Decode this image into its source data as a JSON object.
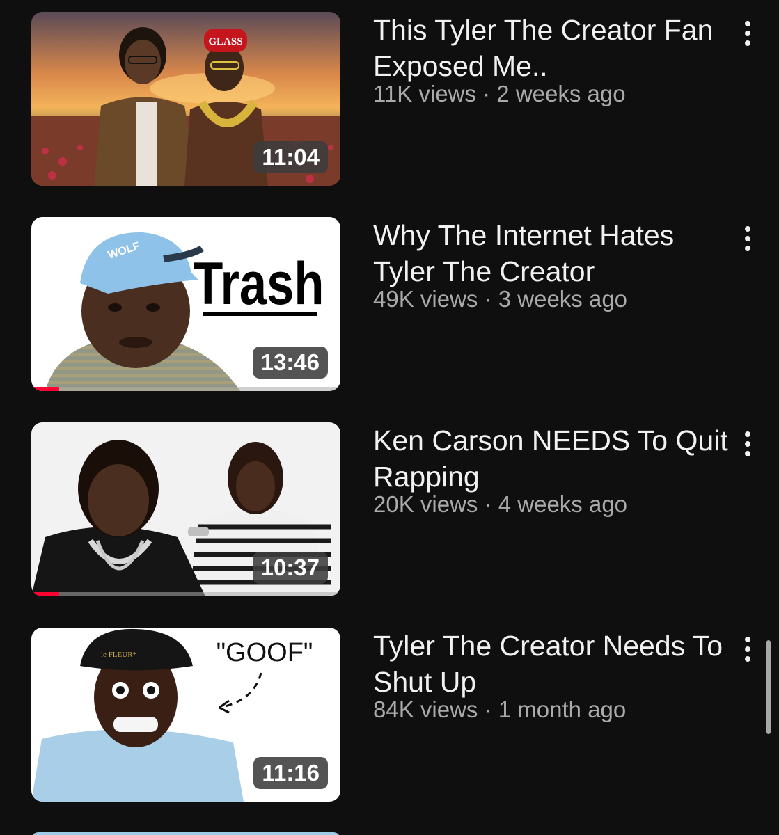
{
  "videos": [
    {
      "title": "This Tyler The Creator Fan Exposed Me..",
      "views": "11K views",
      "age": "2 weeks ago",
      "duration": "11:04",
      "watched_fraction": 0,
      "thumb_text": "GLASS"
    },
    {
      "title": "Why The Internet Hates Tyler The Creator",
      "views": "49K views",
      "age": "3 weeks ago",
      "duration": "13:46",
      "watched_fraction": 0.09,
      "thumb_text": "Trash",
      "hat_text": "WOLF"
    },
    {
      "title": "Ken Carson NEEDS To Quit Rapping",
      "views": "20K views",
      "age": "4 weeks ago",
      "duration": "10:37",
      "watched_fraction": 0.09,
      "thumb_text": ""
    },
    {
      "title": "Tyler The Creator Needs To Shut Up",
      "views": "84K views",
      "age": "1 month ago",
      "duration": "11:16",
      "watched_fraction": 0,
      "thumb_text": "\"GOOF\"",
      "hat_text": "le FLEUR*"
    }
  ],
  "separator": "·",
  "colors": {
    "background": "#0f0f0f",
    "title": "#f1f1f1",
    "secondary": "#aaaaaa",
    "progress": "#ff0033"
  },
  "icons": {
    "more": "vertical-ellipsis"
  }
}
